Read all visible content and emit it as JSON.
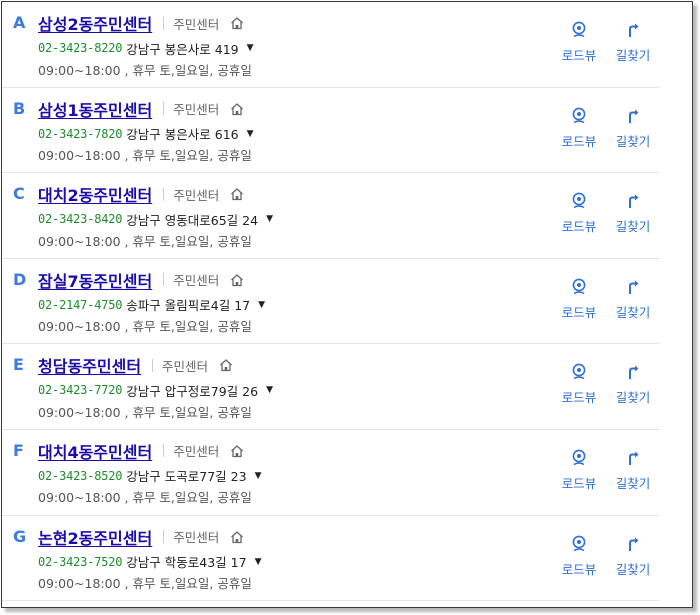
{
  "items": [
    {
      "letter": "A",
      "name": "삼성2동주민센터",
      "category": "주민센터",
      "phone": "02-3423-8220",
      "address": "강남구 봉은사로 419",
      "hours": "09:00~18:00 , 휴무 토,일요일, 공휴일",
      "roadview": "로드뷰",
      "directions": "길찾기"
    },
    {
      "letter": "B",
      "name": "삼성1동주민센터",
      "category": "주민센터",
      "phone": "02-3423-7820",
      "address": "강남구 봉은사로 616",
      "hours": "09:00~18:00 , 휴무 토,일요일, 공휴일",
      "roadview": "로드뷰",
      "directions": "길찾기"
    },
    {
      "letter": "C",
      "name": "대치2동주민센터",
      "category": "주민센터",
      "phone": "02-3423-8420",
      "address": "강남구 영동대로65길 24",
      "hours": "09:00~18:00 , 휴무 토,일요일, 공휴일",
      "roadview": "로드뷰",
      "directions": "길찾기"
    },
    {
      "letter": "D",
      "name": "잠실7동주민센터",
      "category": "주민센터",
      "phone": "02-2147-4750",
      "address": "송파구 올림픽로4길 17",
      "hours": "09:00~18:00 , 휴무 토,일요일, 공휴일",
      "roadview": "로드뷰",
      "directions": "길찾기"
    },
    {
      "letter": "E",
      "name": "청담동주민센터",
      "category": "주민센터",
      "phone": "02-3423-7720",
      "address": "강남구 압구정로79길 26",
      "hours": "09:00~18:00 , 휴무 토,일요일, 공휴일",
      "roadview": "로드뷰",
      "directions": "길찾기"
    },
    {
      "letter": "F",
      "name": "대치4동주민센터",
      "category": "주민센터",
      "phone": "02-3423-8520",
      "address": "강남구 도곡로77길 23",
      "hours": "09:00~18:00 , 휴무 토,일요일, 공휴일",
      "roadview": "로드뷰",
      "directions": "길찾기"
    },
    {
      "letter": "G",
      "name": "논현2동주민센터",
      "category": "주민센터",
      "phone": "02-3423-7520",
      "address": "강남구 학동로43길 17",
      "hours": "09:00~18:00 , 휴무 토,일요일, 공휴일",
      "roadview": "로드뷰",
      "directions": "길찾기"
    }
  ],
  "icons": {
    "home": "home-icon",
    "roadview": "roadview-icon",
    "directions": "directions-icon",
    "expand": "triangle-down-icon"
  },
  "colors": {
    "letter": "#3d7be0",
    "name": "#1a0dab",
    "phone": "#1e8c2e",
    "action": "#2f6fd6"
  },
  "expand_glyph": "▼"
}
